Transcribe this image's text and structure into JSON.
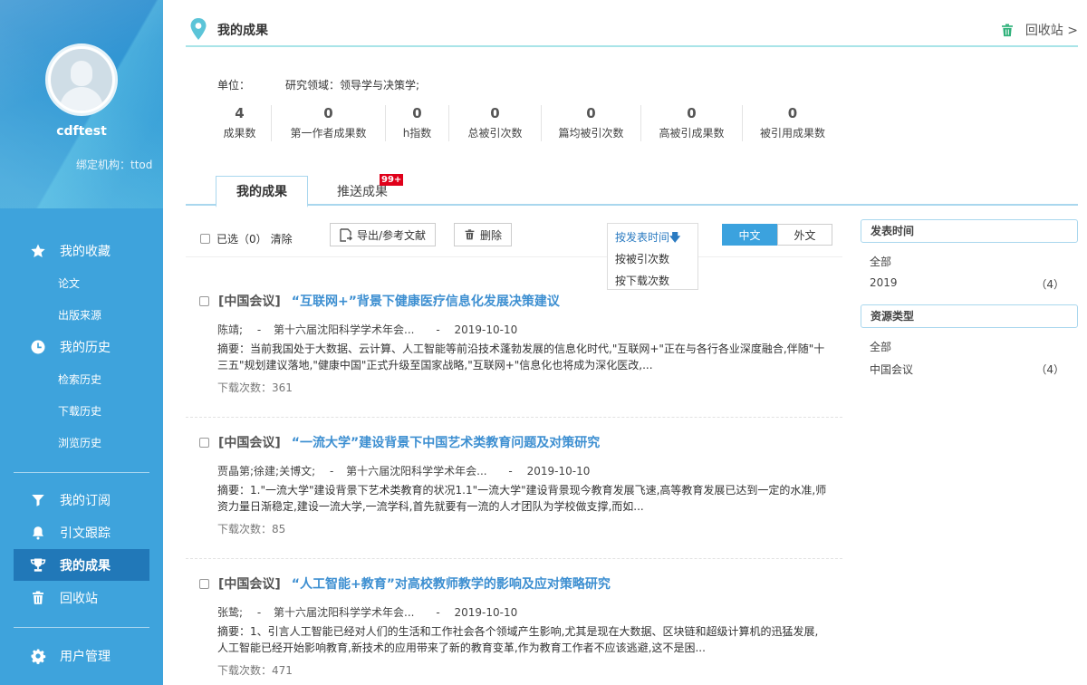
{
  "sidebar": {
    "username": "cdftest",
    "institution": "绑定机构：ttod",
    "menu": {
      "favorites": "我的收藏",
      "fav_papers": "论文",
      "fav_sources": "出版来源",
      "history": "我的历史",
      "search_history": "检索历史",
      "download_history": "下载历史",
      "browse_history": "浏览历史",
      "subscriptions": "我的订阅",
      "citation_tracking": "引文跟踪",
      "achievements": "我的成果",
      "recycle_bin": "回收站",
      "user_management": "用户管理"
    }
  },
  "header": {
    "title": "我的成果",
    "recycle_link": "回收站 >"
  },
  "profile": {
    "unit_label": "单位：",
    "research_field": "研究领域：领导学与决策学;"
  },
  "stats": [
    {
      "value": "4",
      "label": "成果数"
    },
    {
      "value": "0",
      "label": "第一作者成果数"
    },
    {
      "value": "0",
      "label": "h指数"
    },
    {
      "value": "0",
      "label": "总被引次数"
    },
    {
      "value": "0",
      "label": "篇均被引次数"
    },
    {
      "value": "0",
      "label": "高被引成果数"
    },
    {
      "value": "0",
      "label": "被引用成果数"
    }
  ],
  "tabs": {
    "mine": "我的成果",
    "pushed": "推送成果",
    "pushed_badge": "99+"
  },
  "toolbar": {
    "selected": "已选（0）",
    "clear": "清除",
    "export": "导出/参考文献",
    "delete": "删除",
    "sort_options": [
      "按发表时间",
      "按被引次数",
      "按下载次数"
    ],
    "lang_cn": "中文",
    "lang_foreign": "外文"
  },
  "results": [
    {
      "type": "[中国会议]",
      "title": "“互联网+”背景下健康医疗信息化发展决策建议",
      "authors": "陈靖;",
      "dash1": "-",
      "venue": "第十六届沈阳科学学术年会...",
      "dash2": "-",
      "date": "2019-10-10",
      "abstract": "摘要：当前我国处于大数据、云计算、人工智能等前沿技术蓬勃发展的信息化时代,\"互联网+\"正在与各行各业深度融合,伴随\"十三五\"规划建议落地,\"健康中国\"正式升级至国家战略,\"互联网+\"信息化也将成为深化医改,...",
      "downloads_label": "下载次数：",
      "downloads": "361"
    },
    {
      "type": "[中国会议]",
      "title": "“一流大学”建设背景下中国艺术类教育问题及对策研究",
      "authors": "贾晶第;徐建;关博文;",
      "dash1": "-",
      "venue": "第十六届沈阳科学学术年会...",
      "dash2": "-",
      "date": "2019-10-10",
      "abstract": "摘要：1.\"一流大学\"建设背景下艺术类教育的状况1.1\"一流大学\"建设背景现今教育发展飞速,高等教育发展已达到一定的水准,师资力量日渐稳定,建设一流大学,一流学科,首先就要有一流的人才团队为学校做支撑,而如...",
      "downloads_label": "下载次数：",
      "downloads": "85"
    },
    {
      "type": "[中国会议]",
      "title": "“人工智能+教育”对高校教师教学的影响及应对策略研究",
      "authors": "张鸷;",
      "dash1": "-",
      "venue": "第十六届沈阳科学学术年会...",
      "dash2": "-",
      "date": "2019-10-10",
      "abstract": "摘要：1、引言人工智能已经对人们的生活和工作社会各个领域产生影响,尤其是现在大数据、区块链和超级计算机的迅猛发展,人工智能已经开始影响教育,新技术的应用带来了新的教育变革,作为教育工作者不应该逃避,这不是困...",
      "downloads_label": "下载次数：",
      "downloads": "471"
    }
  ],
  "facets": {
    "pub_time_title": "发表时间",
    "pub_time_all": "全部",
    "pub_time_year": "2019",
    "pub_time_count": "（4）",
    "res_type_title": "资源类型",
    "res_type_all": "全部",
    "res_type_item": "中国会议",
    "res_type_count": "（4）"
  }
}
